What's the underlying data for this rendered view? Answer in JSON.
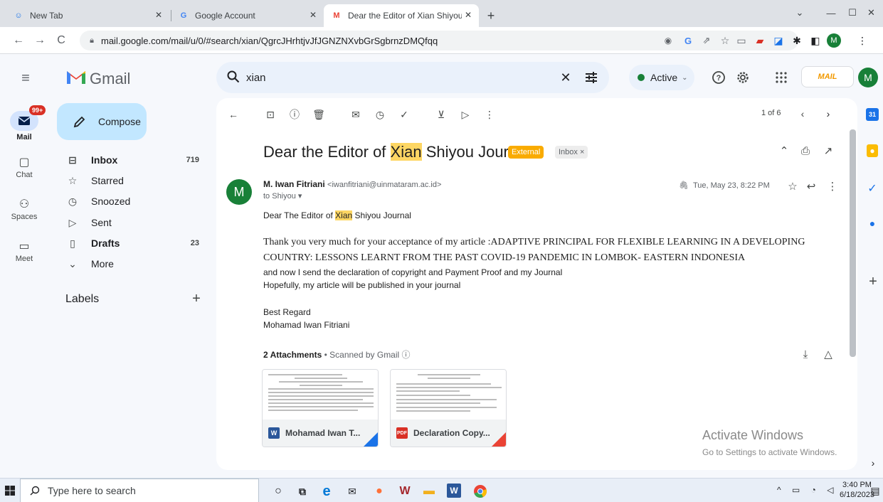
{
  "browser": {
    "tabs": [
      {
        "label": "New Tab",
        "active": false
      },
      {
        "label": "Google Account",
        "active": false
      },
      {
        "label": "Dear the Editor of Xian Shiyou Jo",
        "active": true
      }
    ],
    "new_tab_symbol": "+",
    "url": "mail.google.com/mail/u/0/#search/xian/QgrcJHrhtjvJfJGNZNXvbGrSgbrnzDMQfqq",
    "profile_initial": "M"
  },
  "gmail": {
    "app_name": "Gmail",
    "search_value": "xian",
    "status": "Active",
    "account_initial": "M",
    "workspace_logo_text": "MAIL"
  },
  "rail": {
    "mail_badge": "99+",
    "items": [
      {
        "label": "Mail",
        "icon": "mail-icon"
      },
      {
        "label": "Chat",
        "icon": "chat-icon"
      },
      {
        "label": "Spaces",
        "icon": "spaces-icon"
      },
      {
        "label": "Meet",
        "icon": "meet-icon"
      }
    ]
  },
  "compose_label": "Compose",
  "nav": [
    {
      "label": "Inbox",
      "count": "719",
      "icon": "inbox-icon",
      "bold": true
    },
    {
      "label": "Starred",
      "count": "",
      "icon": "star-icon",
      "bold": false
    },
    {
      "label": "Snoozed",
      "count": "",
      "icon": "clock-icon",
      "bold": false
    },
    {
      "label": "Sent",
      "count": "",
      "icon": "send-icon",
      "bold": false
    },
    {
      "label": "Drafts",
      "count": "23",
      "icon": "draft-icon",
      "bold": true
    },
    {
      "label": "More",
      "count": "",
      "icon": "chevron-down-icon",
      "bold": false
    }
  ],
  "labels_title": "Labels",
  "toolbar": {
    "pager": "1 of 6"
  },
  "message": {
    "subject_prefix": "Dear the Editor of ",
    "subject_highlight": "Xian",
    "subject_suffix": " Shiyou Journal",
    "tag_external": "External",
    "tag_inbox": "Inbox ×",
    "sender_avatar": "M",
    "sender_name": "M. Iwan Fitriani",
    "sender_email": "<iwanfitriani@uinmataram.ac.id>",
    "recipient": "to Shiyou ▾",
    "date": "Tue, May 23, 8:22 PM",
    "greeting_prefix": "Dear The Editor of ",
    "greeting_highlight": "Xian",
    "greeting_suffix": " Shiyou Journal",
    "line1": "Thank you very much for your acceptance of my article :ADAPTIVE PRINCIPAL FOR FLEXIBLE LEARNING IN A DEVELOPING",
    "line2": "COUNTRY: LESSONS LEARNT FROM THE PAST COVID-19 PANDEMIC IN LOMBOK- EASTERN INDONESIA",
    "line3": "and now I send the declaration of copyright and Payment Proof  and my Journal",
    "line4": "Hopefully, my article will be published in your journal",
    "closing1": "Best Regard",
    "closing2": "Mohamad Iwan Fitriani"
  },
  "attachments": {
    "count_label": "2 Attachments",
    "scanned": "Scanned by Gmail ⓘ",
    "items": [
      {
        "name": "Mohamad Iwan T...",
        "type": "W",
        "type_color": "#2b579a",
        "corner_color": "#1a73e8"
      },
      {
        "name": "Declaration Copy...",
        "type": "PDF",
        "type_color": "#d93025",
        "corner_color": "#ea4335"
      }
    ]
  },
  "watermark": {
    "title": "Activate Windows",
    "subtitle": "Go to Settings to activate Windows."
  },
  "taskbar": {
    "search_placeholder": "Type here to search",
    "time": "3:40 PM",
    "date": "6/18/2023"
  }
}
